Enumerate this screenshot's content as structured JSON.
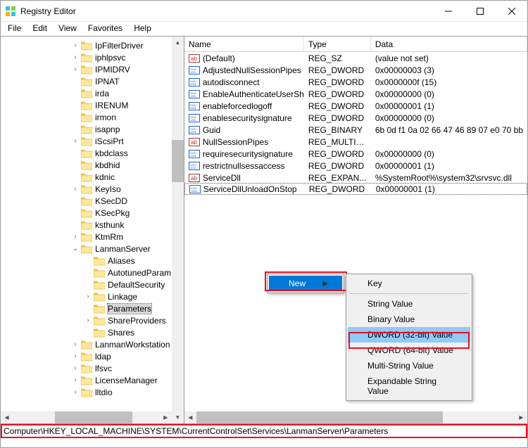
{
  "window": {
    "title": "Registry Editor"
  },
  "menubar": [
    "File",
    "Edit",
    "View",
    "Favorites",
    "Help"
  ],
  "tree": [
    {
      "indent": 100,
      "expand": ">",
      "label": "IpFilterDriver"
    },
    {
      "indent": 100,
      "expand": ">",
      "label": "iphlpsvc"
    },
    {
      "indent": 100,
      "expand": ">",
      "label": "IPMIDRV"
    },
    {
      "indent": 100,
      "expand": "",
      "label": "IPNAT"
    },
    {
      "indent": 100,
      "expand": "",
      "label": "irda"
    },
    {
      "indent": 100,
      "expand": "",
      "label": "IRENUM"
    },
    {
      "indent": 100,
      "expand": "",
      "label": "irmon"
    },
    {
      "indent": 100,
      "expand": "",
      "label": "isapnp"
    },
    {
      "indent": 100,
      "expand": ">",
      "label": "iScsiPrt"
    },
    {
      "indent": 100,
      "expand": "",
      "label": "kbdclass"
    },
    {
      "indent": 100,
      "expand": "",
      "label": "kbdhid"
    },
    {
      "indent": 100,
      "expand": "",
      "label": "kdnic"
    },
    {
      "indent": 100,
      "expand": ">",
      "label": "KeyIso"
    },
    {
      "indent": 100,
      "expand": "",
      "label": "KSecDD"
    },
    {
      "indent": 100,
      "expand": "",
      "label": "KSecPkg"
    },
    {
      "indent": 100,
      "expand": "",
      "label": "ksthunk"
    },
    {
      "indent": 100,
      "expand": ">",
      "label": "KtmRm"
    },
    {
      "indent": 100,
      "expand": "v",
      "label": "LanmanServer"
    },
    {
      "indent": 118,
      "expand": "",
      "label": "Aliases"
    },
    {
      "indent": 118,
      "expand": "",
      "label": "AutotunedParam"
    },
    {
      "indent": 118,
      "expand": "",
      "label": "DefaultSecurity"
    },
    {
      "indent": 118,
      "expand": ">",
      "label": "Linkage"
    },
    {
      "indent": 118,
      "expand": "",
      "label": "Parameters",
      "selected": true
    },
    {
      "indent": 118,
      "expand": ">",
      "label": "ShareProviders"
    },
    {
      "indent": 118,
      "expand": "",
      "label": "Shares"
    },
    {
      "indent": 100,
      "expand": ">",
      "label": "LanmanWorkstation"
    },
    {
      "indent": 100,
      "expand": ">",
      "label": "ldap"
    },
    {
      "indent": 100,
      "expand": ">",
      "label": "lfsvc"
    },
    {
      "indent": 100,
      "expand": ">",
      "label": "LicenseManager"
    },
    {
      "indent": 100,
      "expand": ">",
      "label": "lltdio"
    }
  ],
  "list": {
    "columns": [
      "Name",
      "Type",
      "Data"
    ],
    "rows": [
      {
        "icon": "ab",
        "name": "(Default)",
        "type": "REG_SZ",
        "data": "(value not set)"
      },
      {
        "icon": "bin",
        "name": "AdjustedNullSessionPipes",
        "type": "REG_DWORD",
        "data": "0x00000003 (3)"
      },
      {
        "icon": "bin",
        "name": "autodisconnect",
        "type": "REG_DWORD",
        "data": "0x0000000f (15)"
      },
      {
        "icon": "bin",
        "name": "EnableAuthenticateUserSha...",
        "type": "REG_DWORD",
        "data": "0x00000000 (0)"
      },
      {
        "icon": "bin",
        "name": "enableforcedlogoff",
        "type": "REG_DWORD",
        "data": "0x00000001 (1)"
      },
      {
        "icon": "bin",
        "name": "enablesecuritysignature",
        "type": "REG_DWORD",
        "data": "0x00000000 (0)"
      },
      {
        "icon": "bin",
        "name": "Guid",
        "type": "REG_BINARY",
        "data": "6b 0d f1 0a 02 66 47 46 89 07 e0 70 bb"
      },
      {
        "icon": "ab",
        "name": "NullSessionPipes",
        "type": "REG_MULTI_...",
        "data": ""
      },
      {
        "icon": "bin",
        "name": "requiresecuritysignature",
        "type": "REG_DWORD",
        "data": "0x00000000 (0)"
      },
      {
        "icon": "bin",
        "name": "restrictnullsessaccess",
        "type": "REG_DWORD",
        "data": "0x00000001 (1)"
      },
      {
        "icon": "ab",
        "name": "ServiceDll",
        "type": "REG_EXPAN...",
        "data": "%SystemRoot%\\system32\\srvsvc.dll"
      },
      {
        "icon": "bin",
        "name": "ServiceDllUnloadOnStop",
        "type": "REG_DWORD",
        "data": "0x00000001 (1)",
        "selected": true
      }
    ]
  },
  "context1": {
    "label": "New"
  },
  "context2": {
    "items": [
      {
        "label": "Key"
      },
      {
        "sep": true
      },
      {
        "label": "String Value"
      },
      {
        "label": "Binary Value"
      },
      {
        "label": "DWORD (32-bit) Value",
        "highlight": true
      },
      {
        "label": "QWORD (64-bit) Value"
      },
      {
        "label": "Multi-String Value"
      },
      {
        "label": "Expandable String Value"
      }
    ]
  },
  "statusbar": "Computer\\HKEY_LOCAL_MACHINE\\SYSTEM\\CurrentControlSet\\Services\\LanmanServer\\Parameters"
}
